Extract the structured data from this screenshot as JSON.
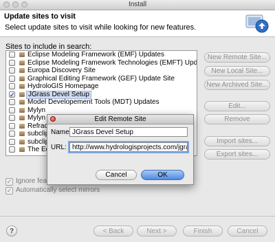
{
  "window": {
    "title": "Install"
  },
  "header": {
    "title": "Update sites to visit",
    "description": "Select update sites to visit while looking for new features.",
    "icon": "install-wizard-icon"
  },
  "sites": {
    "label": "Sites to include in search:",
    "items": [
      {
        "label": "Eclipse Modeling Framework (EMF) Updates",
        "checked": false
      },
      {
        "label": "Eclipse Modeling Framework Technologies (EMFT) Updates",
        "checked": false
      },
      {
        "label": "Europa Discovery Site",
        "checked": false
      },
      {
        "label": "Graphical Editing Framework (GEF) Update Site",
        "checked": false
      },
      {
        "label": "HydroloGIS Homepage",
        "checked": false
      },
      {
        "label": "JGrass Devel Setup",
        "checked": true
      },
      {
        "label": "Model Developement Tools (MDT) Updates",
        "checked": false
      },
      {
        "label": "Mylyn",
        "checked": false
      },
      {
        "label": "Mylyn Ex",
        "checked": false
      },
      {
        "label": "Refracti",
        "checked": false
      },
      {
        "label": "subclips",
        "checked": false
      },
      {
        "label": "subclips",
        "checked": false
      },
      {
        "label": "The Ecli",
        "checked": false
      }
    ]
  },
  "side_buttons": {
    "new_remote": "New Remote Site...",
    "new_local": "New Local Site...",
    "new_archived": "New Archived Site...",
    "edit": "Edit...",
    "remove": "Remove",
    "import": "Import sites...",
    "export": "Export sites..."
  },
  "options": {
    "ignore_label": "Ignore featur",
    "mirrors_label": "Automatically select mirrors"
  },
  "footer": {
    "help": "?",
    "back": "< Back",
    "next": "Next >",
    "finish": "Finish",
    "cancel": "Cancel"
  },
  "dialog": {
    "title": "Edit Remote Site",
    "name_label": "Name:",
    "name_value": "JGrass Devel Setup",
    "url_label": "URL:",
    "url_value": "http://www.hydrologisprojects.com/jgrass-",
    "cancel_label": "Cancel",
    "ok_label": "OK"
  },
  "colors": {
    "ok_button": "#4d8ae0",
    "selection": "#cfdcf0",
    "close_button": "#d0261a"
  }
}
